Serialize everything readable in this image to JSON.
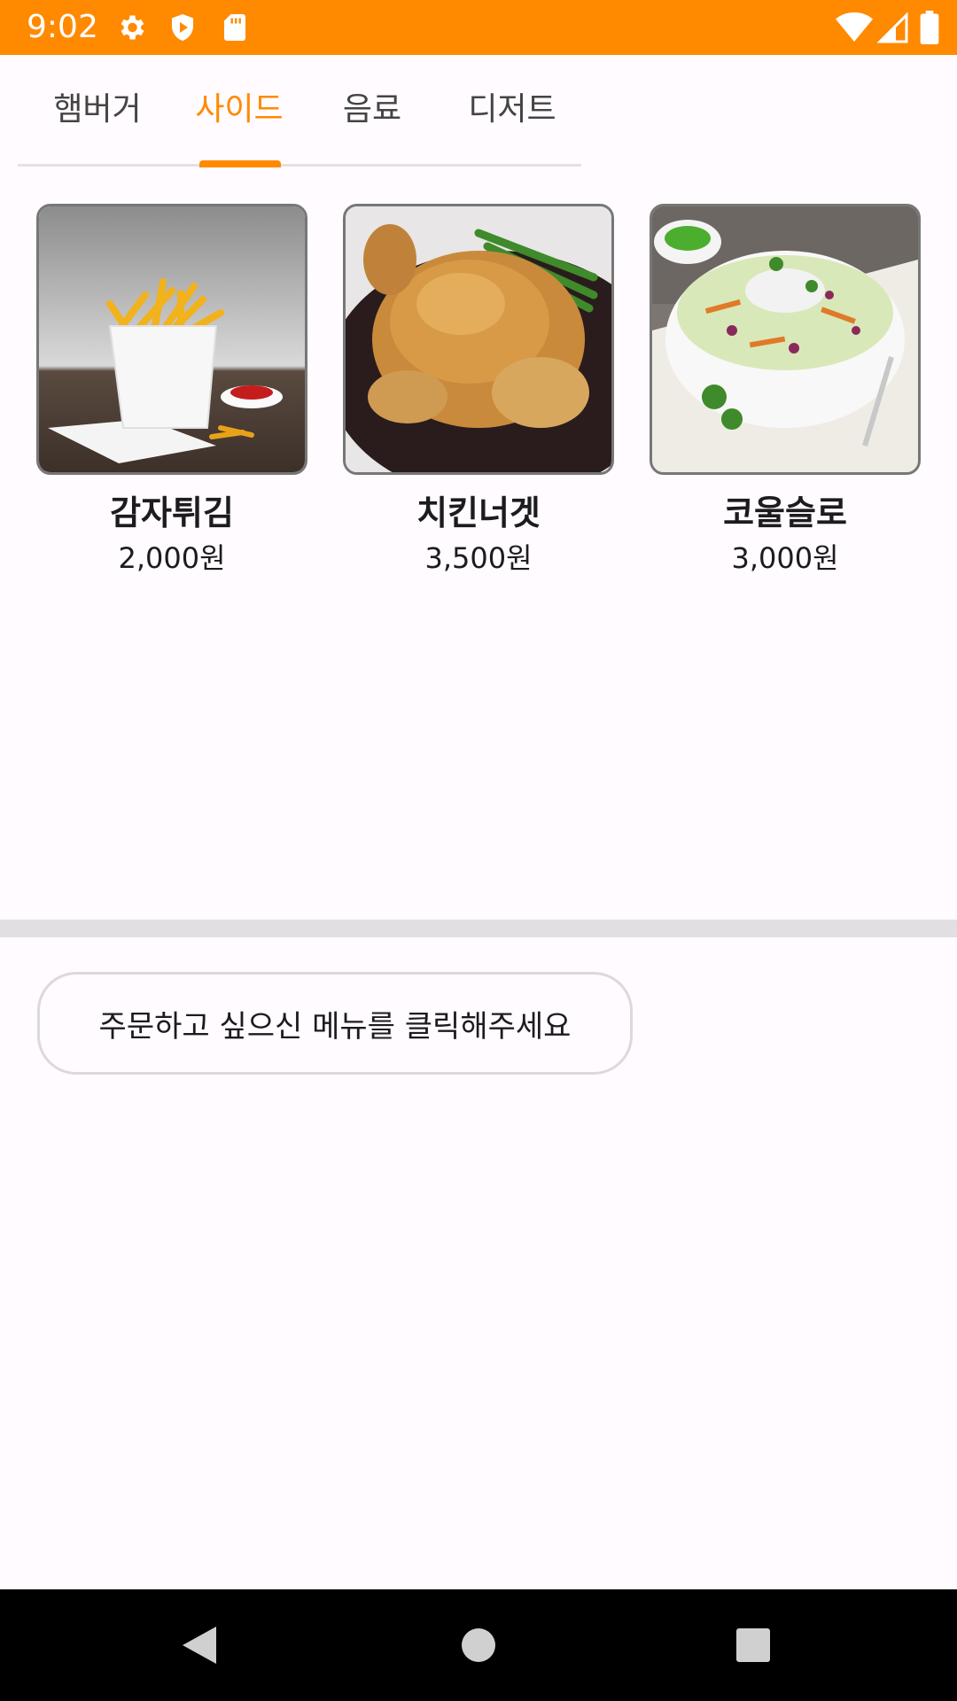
{
  "status_bar": {
    "time": "9:02",
    "color": "#ff8a00",
    "icons": [
      "gear-icon",
      "shield-play-icon",
      "sd-card-icon",
      "wifi-icon",
      "signal-icon",
      "battery-icon"
    ]
  },
  "tabs": [
    {
      "label": "햄버거",
      "selected": false
    },
    {
      "label": "사이드",
      "selected": true
    },
    {
      "label": "음료",
      "selected": false
    },
    {
      "label": "디저트",
      "selected": false
    }
  ],
  "accent_color": "#ff8a00",
  "menu": [
    {
      "name": "감자튀김",
      "price": "2,000원",
      "image": "french-fries"
    },
    {
      "name": "치킨너겟",
      "price": "3,500원",
      "image": "roast-chicken"
    },
    {
      "name": "코울슬로",
      "price": "3,000원",
      "image": "coleslaw-bowl"
    }
  ],
  "message": "주문하고 싶으신 메뉴를 클릭해주세요",
  "nav": [
    "back-icon",
    "home-icon",
    "recents-icon"
  ]
}
